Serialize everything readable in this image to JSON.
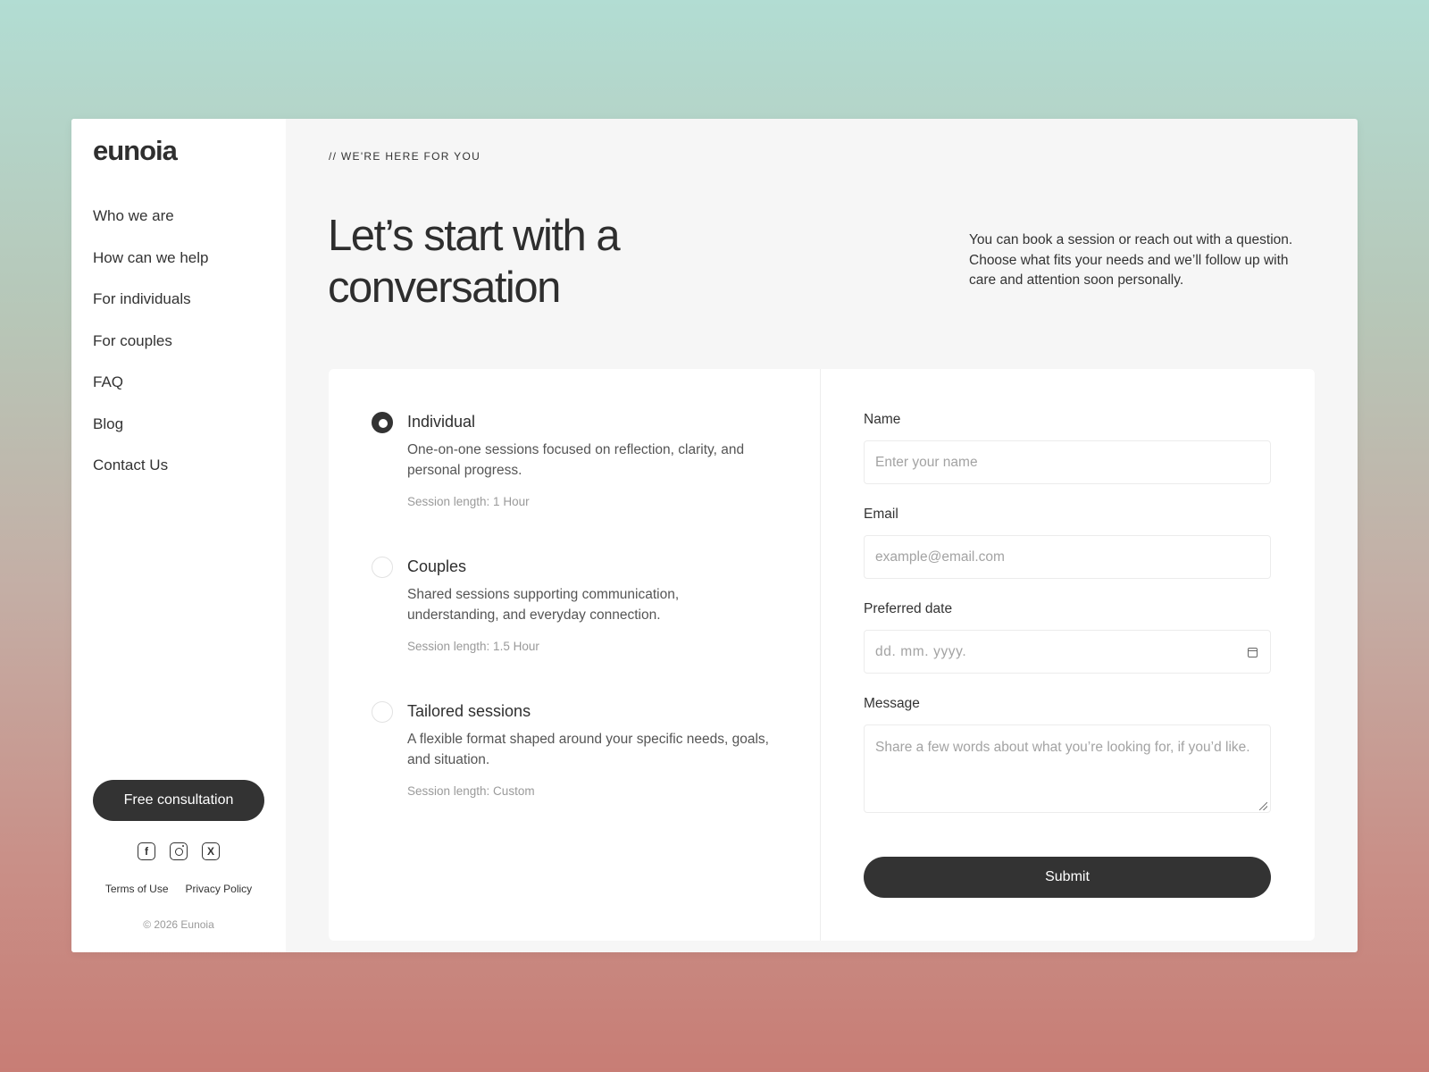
{
  "sidebar": {
    "logo": "eunoia",
    "nav": [
      "Who we are",
      "How can we help",
      "For individuals",
      "For couples",
      "FAQ",
      "Blog",
      "Contact Us"
    ],
    "cta_label": "Free consultation",
    "socials": [
      "facebook-icon",
      "instagram-icon",
      "x-icon"
    ],
    "legal": {
      "terms": "Terms of Use",
      "privacy": "Privacy Policy"
    },
    "copyright": "© 2026 Eunoia"
  },
  "main": {
    "eyebrow": "// WE'RE HERE FOR YOU",
    "headline": "Let’s start with a conversation",
    "intro": "You can book a session or reach out with a question. Choose what fits your needs and we’ll follow up with care and attention soon personally."
  },
  "options": [
    {
      "title": "Individual",
      "description": "One-on-one sessions focused on reflection, clarity, and personal progress.",
      "length": "Session length: 1 Hour",
      "selected": true
    },
    {
      "title": "Couples",
      "description": "Shared sessions supporting communication, understanding, and everyday connection.",
      "length": "Session length: 1.5 Hour",
      "selected": false
    },
    {
      "title": "Tailored sessions",
      "description": "A flexible format shaped around your specific needs, goals, and situation.",
      "length": "Session length: Custom",
      "selected": false
    }
  ],
  "form": {
    "name": {
      "label": "Name",
      "placeholder": "Enter your name"
    },
    "email": {
      "label": "Email",
      "placeholder": "example@email.com"
    },
    "date": {
      "label": "Preferred date",
      "placeholder": "dd. mm. yyyy."
    },
    "message": {
      "label": "Message",
      "placeholder": "Share a few words about what you’re looking for, if you’d like."
    },
    "submit_label": "Submit"
  },
  "colors": {
    "accent": "#333333",
    "card": "#ffffff",
    "panel": "#f6f6f6"
  }
}
